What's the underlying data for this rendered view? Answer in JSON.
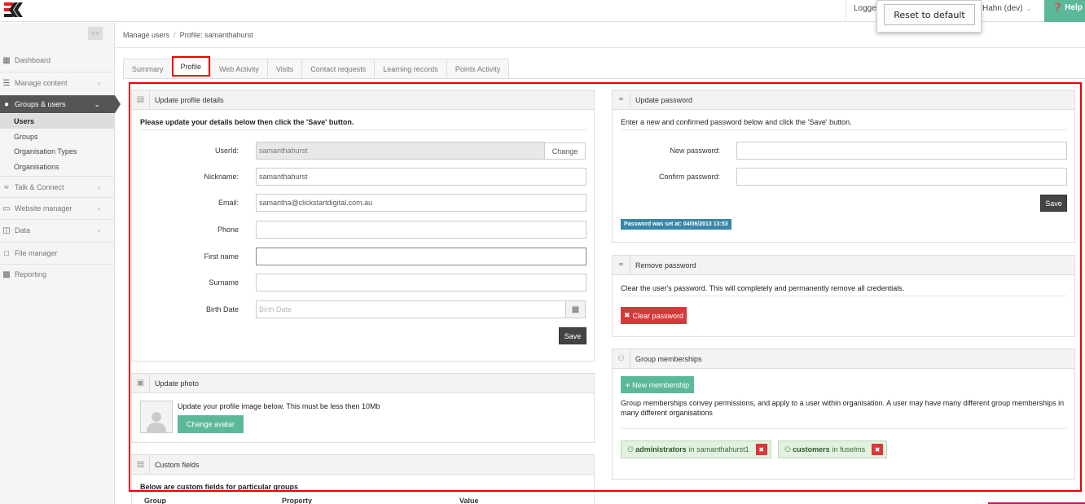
{
  "topbar": {
    "logged_prefix": "Logge",
    "user_suffix": "Hahn (dev)",
    "help_label": "Help",
    "reset_label": "Reset to default"
  },
  "sidebar": {
    "items": [
      {
        "label": "Dashboard"
      },
      {
        "label": "Manage content"
      },
      {
        "label": "Groups & users"
      },
      {
        "label": "Talk & Connect"
      },
      {
        "label": "Website manager"
      },
      {
        "label": "Data"
      },
      {
        "label": "File manager"
      },
      {
        "label": "Reporting"
      }
    ],
    "subitems": [
      "Users",
      "Groups",
      "Organisation Types",
      "Organisations"
    ]
  },
  "breadcrumb": {
    "root": "Manage users",
    "current": "Profile: samanthahurst"
  },
  "tabs": [
    "Summary",
    "Profile",
    "Web Activity",
    "Visits",
    "Contact requests",
    "Learning records",
    "Points Activity"
  ],
  "profile": {
    "title": "Update profile details",
    "intro": "Please update your details below then click the 'Save' button.",
    "fields": [
      {
        "label": "UserId:",
        "value": "samanthahurst"
      },
      {
        "label": "Nickname:",
        "value": "samanthahurst"
      },
      {
        "label": "Email:",
        "value": "samantha@clickstartdigital.com.au"
      },
      {
        "label": "Phone",
        "value": ""
      },
      {
        "label": "First name",
        "value": ""
      },
      {
        "label": "Surname",
        "value": ""
      },
      {
        "label": "Birth Date",
        "value": "",
        "placeholder": "Birth Date"
      }
    ],
    "change_label": "Change",
    "save_label": "Save"
  },
  "photo": {
    "title": "Update photo",
    "text": "Update your profile image below. This must be less then 10Mb",
    "button": "Change avatar"
  },
  "custom_fields": {
    "title": "Custom fields",
    "intro": "Below are custom fields for particular groups",
    "columns": [
      "Group",
      "Property",
      "Value"
    ]
  },
  "password": {
    "title": "Update password",
    "intro": "Enter a new and confirmed password below and click the 'Save' button.",
    "new_label": "New password:",
    "confirm_label": "Confirm password:",
    "save_label": "Save",
    "badge": "Password was set at: 04/06/2013 13:53"
  },
  "remove_password": {
    "title": "Remove password",
    "text": "Clear the user's password. This will completely and permanently remove all credentials.",
    "button": "Clear password"
  },
  "memberships": {
    "title": "Group memberships",
    "new_button": "New membership",
    "description": "Group memberships convey permissions, and apply to a user within organisation. A user may have many different group memberships in many different organisations",
    "items": [
      {
        "group": "administrators",
        "in_text": "in samanthahurst1"
      },
      {
        "group": "customers",
        "in_text": "in fuselms"
      }
    ]
  },
  "colors": {
    "accent_teal": "#5cb89b",
    "danger": "#d9383a",
    "sidebar_active": "#555555",
    "highlight": "#ee0000"
  }
}
